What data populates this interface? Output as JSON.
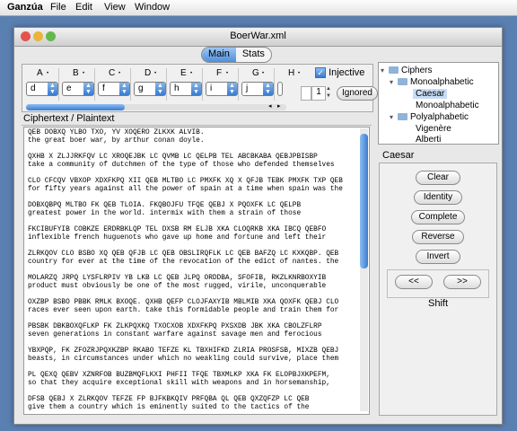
{
  "menubar": {
    "app": "Ganzúa",
    "file": "File",
    "edit": "Edit",
    "view": "View",
    "window": "Window"
  },
  "window": {
    "title": "BoerWar.xml"
  },
  "tabs": {
    "main": "Main",
    "stats": "Stats"
  },
  "columns": [
    {
      "letter": "A",
      "value": "d"
    },
    {
      "letter": "B",
      "value": "e"
    },
    {
      "letter": "C",
      "value": "f"
    },
    {
      "letter": "D",
      "value": "g"
    },
    {
      "letter": "E",
      "value": "h"
    },
    {
      "letter": "F",
      "value": "i"
    },
    {
      "letter": "G",
      "value": "j"
    },
    {
      "letter": "H",
      "value": ""
    }
  ],
  "injective": {
    "label": "Injective",
    "checked": true
  },
  "stepper": {
    "value": "1"
  },
  "ignored_button": "Ignored",
  "text_section_title": "Ciphertext / Plaintext",
  "text_lines": [
    "QEB DOBXQ YLBO TXO, YV XOQERO ZLKXK ALVIB.",
    "the great boer war, by arthur conan doyle.",
    "",
    "QXHB X ZLJJRKFQV LC XROQEJBK LC QVMB LC QELPB TEL ABCBKABA QEBJPBISBP",
    "take a community of dutchmen of the type of those who defended themselves",
    "",
    "CLO CFCQV VBXOP XDXFKPQ XII QEB MLTBO LC PMXFK XQ X QFJB TEBK PMXFK TXP QEB",
    "for fifty years against all the power of spain at a time when spain was the",
    "",
    "DOBXQBPQ MLTBO FK QEB TLOIA. FKQBOJFU TFQE QEBJ X PQOXFK LC QELPB",
    "greatest power in the world. intermix with them a strain of those",
    "",
    "FKCIBUFYIB COBKZE ERDRBKLQP TEL DXSB RM ELJB XKA CLOQRKB XKA IBCQ QEBFO",
    "inflexible french huguenots who gave up home and fortune and left their",
    "",
    "ZLRKQOV CLO BSBO XQ QEB QFJB LC QEB OBSLIRQFLK LC QEB BAFZQ LC KXKQBP. QEB",
    "country for ever at the time of the revocation of the edict of nantes. the",
    "",
    "MOLARZQ JRPQ LYSFLRPIV YB LKB LC QEB JLPQ ORDDBA, SFOFIB, RKZLKNRBOXYIB",
    "product must obviously be one of the most rugged, virile, unconquerable",
    "",
    "OXZBP BSBO PBBK RMLK BXOQE. QXHB QEFP CLOJFAXYIB MBLMIB XKA QOXFK QEBJ CLO",
    "races ever seen upon earth. take this formidable people and train them for",
    "",
    "PBSBK DBKBOXQFLKP FK ZLKPQXKQ TXOCXOB XDXFKPQ PXSXDB JBK XKA CBOLZFLRP",
    "seven generations in constant warfare against savage men and ferocious",
    "",
    "YBXPQP, FK ZFOZRJPQXKZBP RKABO TEFZE KL TBXHIFKD ZLRIA PROSFSB, MIXZB QEBJ",
    "beasts, in circumstances under which no weakling could survive, place them",
    "",
    "PL QEXQ QEBV XZNRFOB BUZBMQFLKXI PHFII TFQE TBXMLKP XKA FK ELOPBJXKPEFM,",
    "so that they acquire exceptional skill with weapons and in horsemanship,",
    "",
    "DFSB QEBJ X ZLRKQOV TEFZE FP BJFKBKQIV PRFQBA QL QEB QXZQFZP LC QEB",
    "give them a country which is eminently suited to the tactics of the"
  ],
  "tree": {
    "root": "Ciphers",
    "mono": "Monoalphabetic",
    "caesar": "Caesar",
    "mono_leaf": "Monoalphabetic",
    "poly": "Polyalphabetic",
    "vigenere": "Vigenère",
    "alberti": "Alberti"
  },
  "caesar_panel": {
    "title": "Caesar",
    "clear": "Clear",
    "identity": "Identity",
    "complete": "Complete",
    "reverse": "Reverse",
    "invert": "Invert",
    "left": "<<",
    "right": ">>",
    "shift": "Shift"
  },
  "colors": {
    "accent": "#3a7bd0",
    "desktop": "#5a7fb1",
    "selection": "#c7dcf5"
  }
}
